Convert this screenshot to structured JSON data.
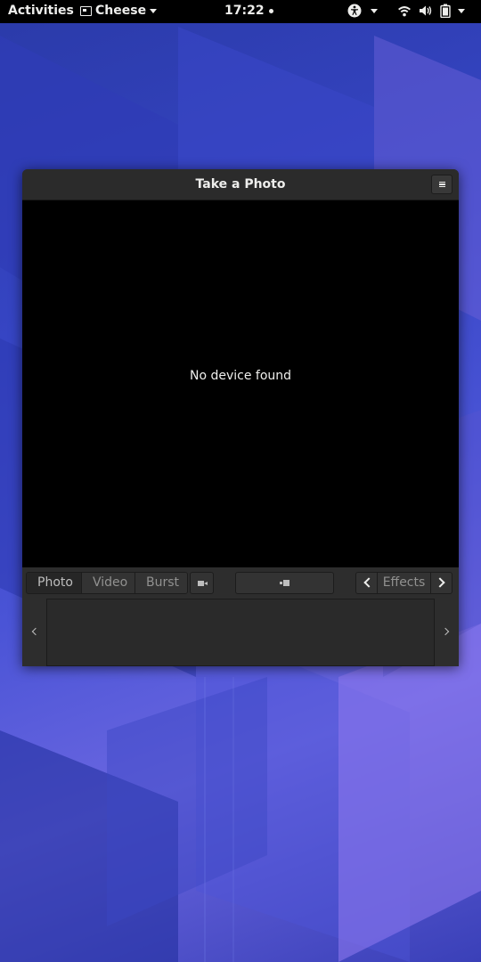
{
  "topbar": {
    "activities": "Activities",
    "app_name": "Cheese",
    "clock": "17:22"
  },
  "window": {
    "title": "Take a Photo",
    "viewport_message": "No device found"
  },
  "toolbar": {
    "modes": [
      "Photo",
      "Video",
      "Burst"
    ],
    "active_mode": "Photo",
    "effects_label": "Effects"
  },
  "icons": {
    "app": "cheese-app-icon",
    "accessibility": "accessibility-icon",
    "wifi": "wifi-icon",
    "volume": "volume-icon",
    "battery": "battery-icon",
    "menu": "hamburger-menu-icon",
    "switch_camera": "camera-switch-icon",
    "shutter": "shutter-icon"
  },
  "colors": {
    "topbar_bg": "#000000",
    "window_bg": "#2d2d2d",
    "viewport_bg": "#000000",
    "text_light": "#eeeeec",
    "text_dim": "#919190"
  }
}
